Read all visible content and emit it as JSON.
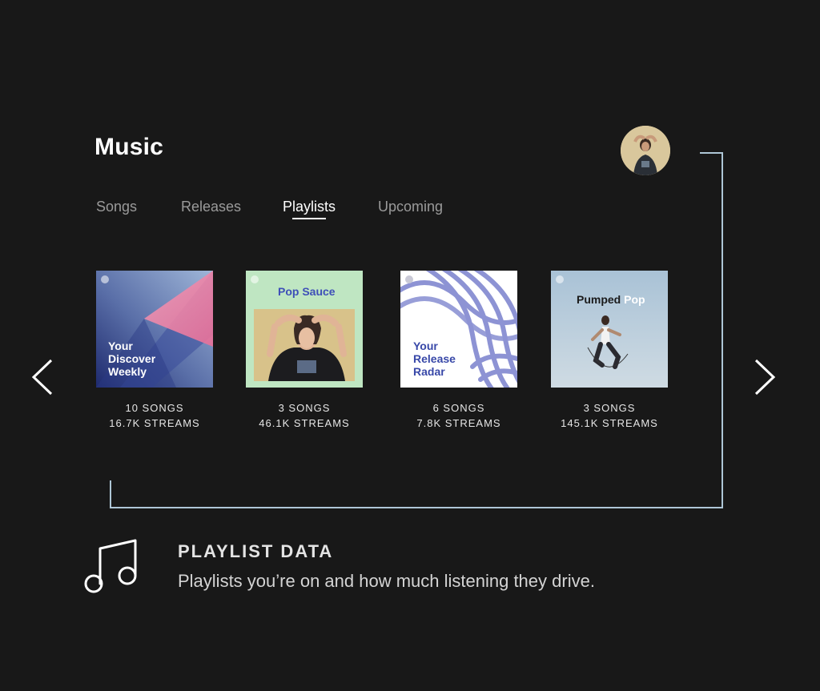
{
  "header": {
    "title": "Music"
  },
  "tabs": [
    {
      "label": "Songs",
      "active": false
    },
    {
      "label": "Releases",
      "active": false
    },
    {
      "label": "Playlists",
      "active": true
    },
    {
      "label": "Upcoming",
      "active": false
    }
  ],
  "navigation": {
    "prev_icon": "chevron-left-icon",
    "next_icon": "chevron-right-icon"
  },
  "playlists": [
    {
      "cover_title": "Your\nDiscover\nWeekly",
      "songs": "10 SONGS",
      "streams": "16.7K STREAMS"
    },
    {
      "cover_title": "Pop Sauce",
      "songs": "3 SONGS",
      "streams": "46.1K STREAMS"
    },
    {
      "cover_title": "Your\nRelease\nRadar",
      "songs": "6 SONGS",
      "streams": "7.8K STREAMS"
    },
    {
      "cover_title_main": "Pumped",
      "cover_title_accent": "Pop",
      "songs": "3 SONGS",
      "streams": "145.1K STREAMS"
    }
  ],
  "info": {
    "icon": "music-note-icon",
    "heading": "PLAYLIST DATA",
    "description": "Playlists you’re on and how much listening they drive."
  },
  "colors": {
    "background": "#181818",
    "bracket": "#aec6d6",
    "pop_sauce_title": "#3e4fb8",
    "release_radar_title": "#3848a8"
  }
}
